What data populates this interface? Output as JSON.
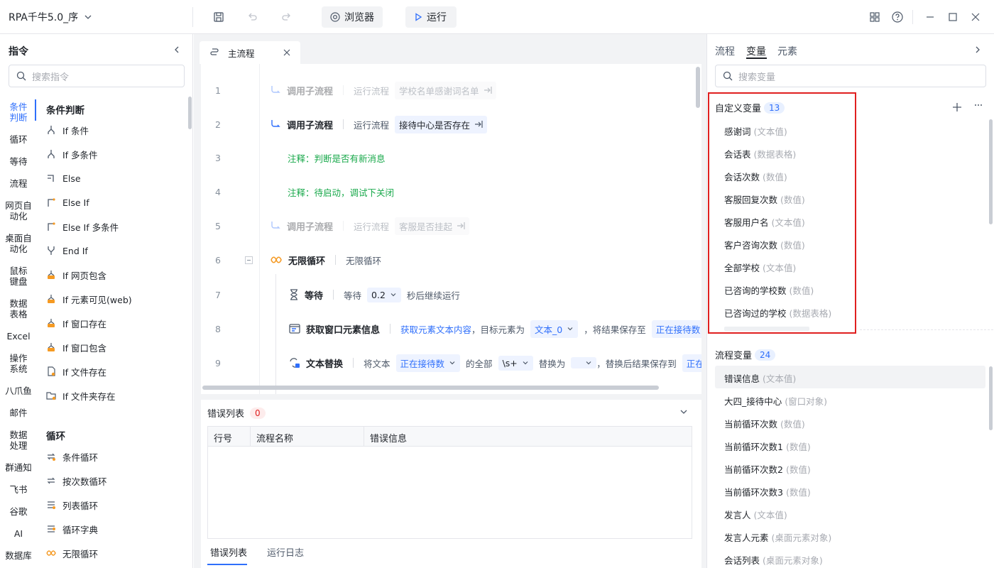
{
  "topbar": {
    "app_title": "RPA千牛5.0_序",
    "browser_label": "浏览器",
    "run_label": "运行"
  },
  "left": {
    "title": "指令",
    "search_placeholder": "搜索指令",
    "categories": [
      "条件判断",
      "循环",
      "等待",
      "流程",
      "网页自动化",
      "桌面自动化",
      "鼠标键盘",
      "数据表格",
      "Excel",
      "操作系统",
      "八爪鱼",
      "邮件",
      "数据处理",
      "群通知",
      "飞书",
      "谷歌",
      "AI",
      "数据库"
    ],
    "section1_title": "条件判断",
    "section1_items": [
      "If 条件",
      "If 多条件",
      "Else",
      "Else If",
      "Else If 多条件",
      "End If",
      "If 网页包含",
      "If 元素可见(web)",
      "If 窗口存在",
      "If 窗口包含",
      "If 文件存在",
      "If 文件夹存在"
    ],
    "section2_title": "循环",
    "section2_items": [
      "条件循环",
      "按次数循环",
      "列表循环",
      "循环字典",
      "无限循环"
    ]
  },
  "editor": {
    "tab_label": "主流程",
    "lines": [
      "1",
      "2",
      "3",
      "4",
      "5",
      "6",
      "7",
      "8",
      "9"
    ],
    "l1": {
      "name": "调用子流程",
      "label": "运行流程",
      "chip": "学校名单感谢词名单"
    },
    "l2": {
      "name": "调用子流程",
      "label": "运行流程",
      "chip": "接待中心是否存在"
    },
    "l3": {
      "text": "注释：判断是否有新消息"
    },
    "l4": {
      "text": "注释：待启动，调试下关闭"
    },
    "l5": {
      "name": "调用子流程",
      "label": "运行流程",
      "chip": "客服是否挂起"
    },
    "l6": {
      "name": "无限循环",
      "label": "无限循环"
    },
    "l7": {
      "name": "等待",
      "pre": "等待",
      "value": "0.2",
      "post": "秒后继续运行"
    },
    "l8": {
      "name": "获取窗口元素信息",
      "part1": "获取元素文本内容",
      "part2": "，目标元素为",
      "chip1": "文本_0",
      "part3": "，将结果保存至",
      "chip2": "正在接待数"
    },
    "l9": {
      "name": "文本替换",
      "part1": "将文本",
      "chip1": "正在接待数",
      "part2": "的全部",
      "chip2": "\\s+",
      "part3": "替换为",
      "part4": "，替换后结果保存到",
      "chip3": "正在接"
    }
  },
  "errors": {
    "title": "错误列表",
    "count": "0",
    "col_line": "行号",
    "col_flow": "流程名称",
    "col_msg": "错误信息",
    "tab_errors": "错误列表",
    "tab_log": "运行日志"
  },
  "right": {
    "tabs": [
      "流程",
      "变量",
      "元素"
    ],
    "search_placeholder": "搜索变量",
    "custom_title": "自定义变量",
    "custom_count": "13",
    "custom_vars": [
      {
        "name": "感谢词",
        "type": "(文本值)"
      },
      {
        "name": "会话表",
        "type": "(数据表格)"
      },
      {
        "name": "会话次数",
        "type": "(数值)"
      },
      {
        "name": "客服回复次数",
        "type": "(数值)"
      },
      {
        "name": "客服用户名",
        "type": "(文本值)"
      },
      {
        "name": "客户咨询次数",
        "type": "(数值)"
      },
      {
        "name": "全部学校",
        "type": "(文本值)"
      },
      {
        "name": "已咨询的学校数",
        "type": "(数值)"
      },
      {
        "name": "已咨询过的学校",
        "type": "(数据表格)"
      }
    ],
    "flow_title": "流程变量",
    "flow_count": "24",
    "flow_vars": [
      {
        "name": "错误信息",
        "type": "(文本值)"
      },
      {
        "name": "大四_接待中心",
        "type": "(窗口对象)"
      },
      {
        "name": "当前循环次数",
        "type": "(数值)"
      },
      {
        "name": "当前循环次数1",
        "type": "(数值)"
      },
      {
        "name": "当前循环次数2",
        "type": "(数值)"
      },
      {
        "name": "当前循环次数3",
        "type": "(数值)"
      },
      {
        "name": "发言人",
        "type": "(文本值)"
      },
      {
        "name": "发言人元素",
        "type": "(桌面元素对象)"
      },
      {
        "name": "会话列表",
        "type": "(桌面元素对象)"
      }
    ]
  },
  "colors": {
    "accent": "#2f6ffb",
    "highlight": "#e02020",
    "comment": "#19a94b"
  }
}
